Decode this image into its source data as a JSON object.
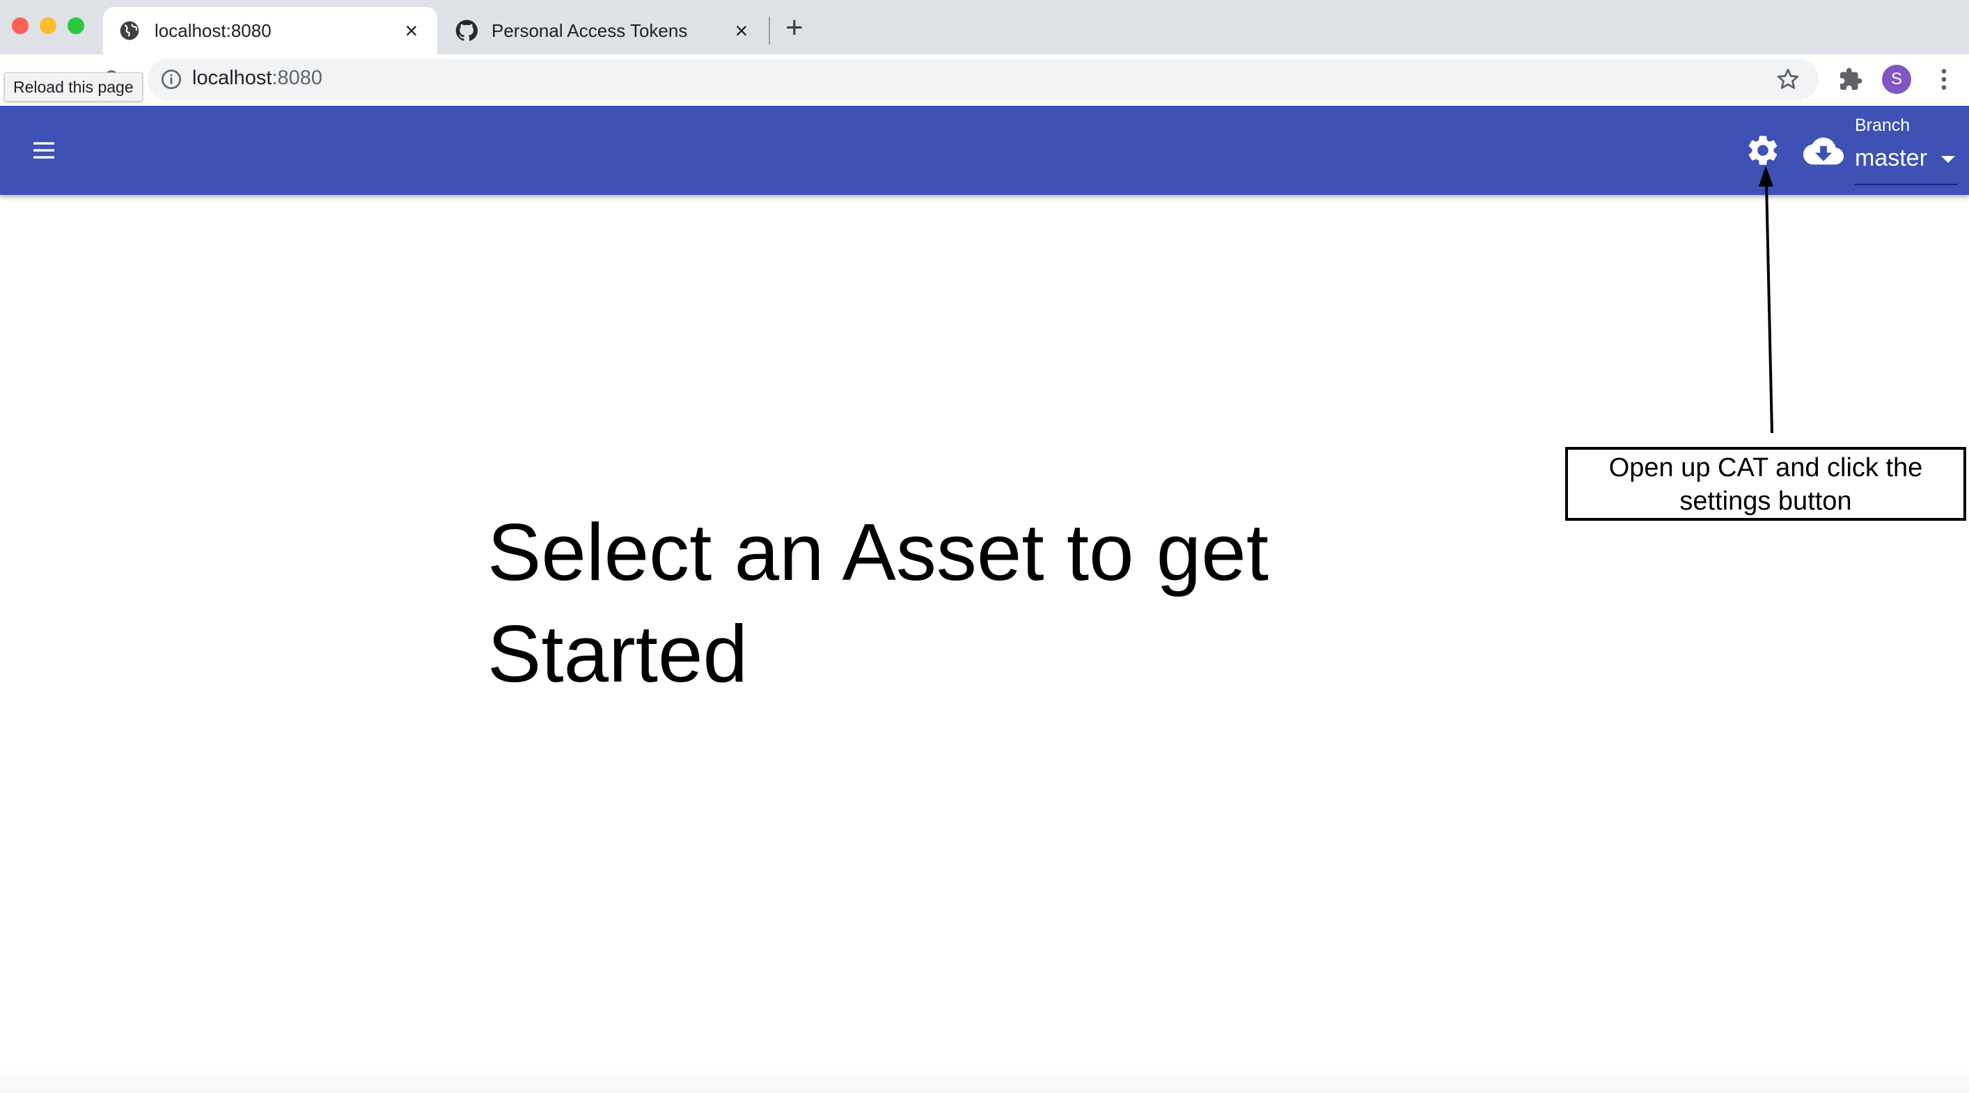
{
  "browser": {
    "tabs": [
      {
        "title": "localhost:8080",
        "close": "×",
        "active": true
      },
      {
        "title": "Personal Access Tokens",
        "close": "×",
        "active": false
      }
    ],
    "new_tab": "+",
    "tooltip": "Reload this page",
    "url": {
      "host": "localhost",
      "port": ":8080"
    },
    "profile_initial": "S"
  },
  "appbar": {
    "color": "#3f51b5",
    "branch_label": "Branch",
    "branch_value": "master"
  },
  "main": {
    "heading": "Select an Asset to get Started"
  },
  "annotation": {
    "text": "Open up CAT and click the settings button"
  }
}
